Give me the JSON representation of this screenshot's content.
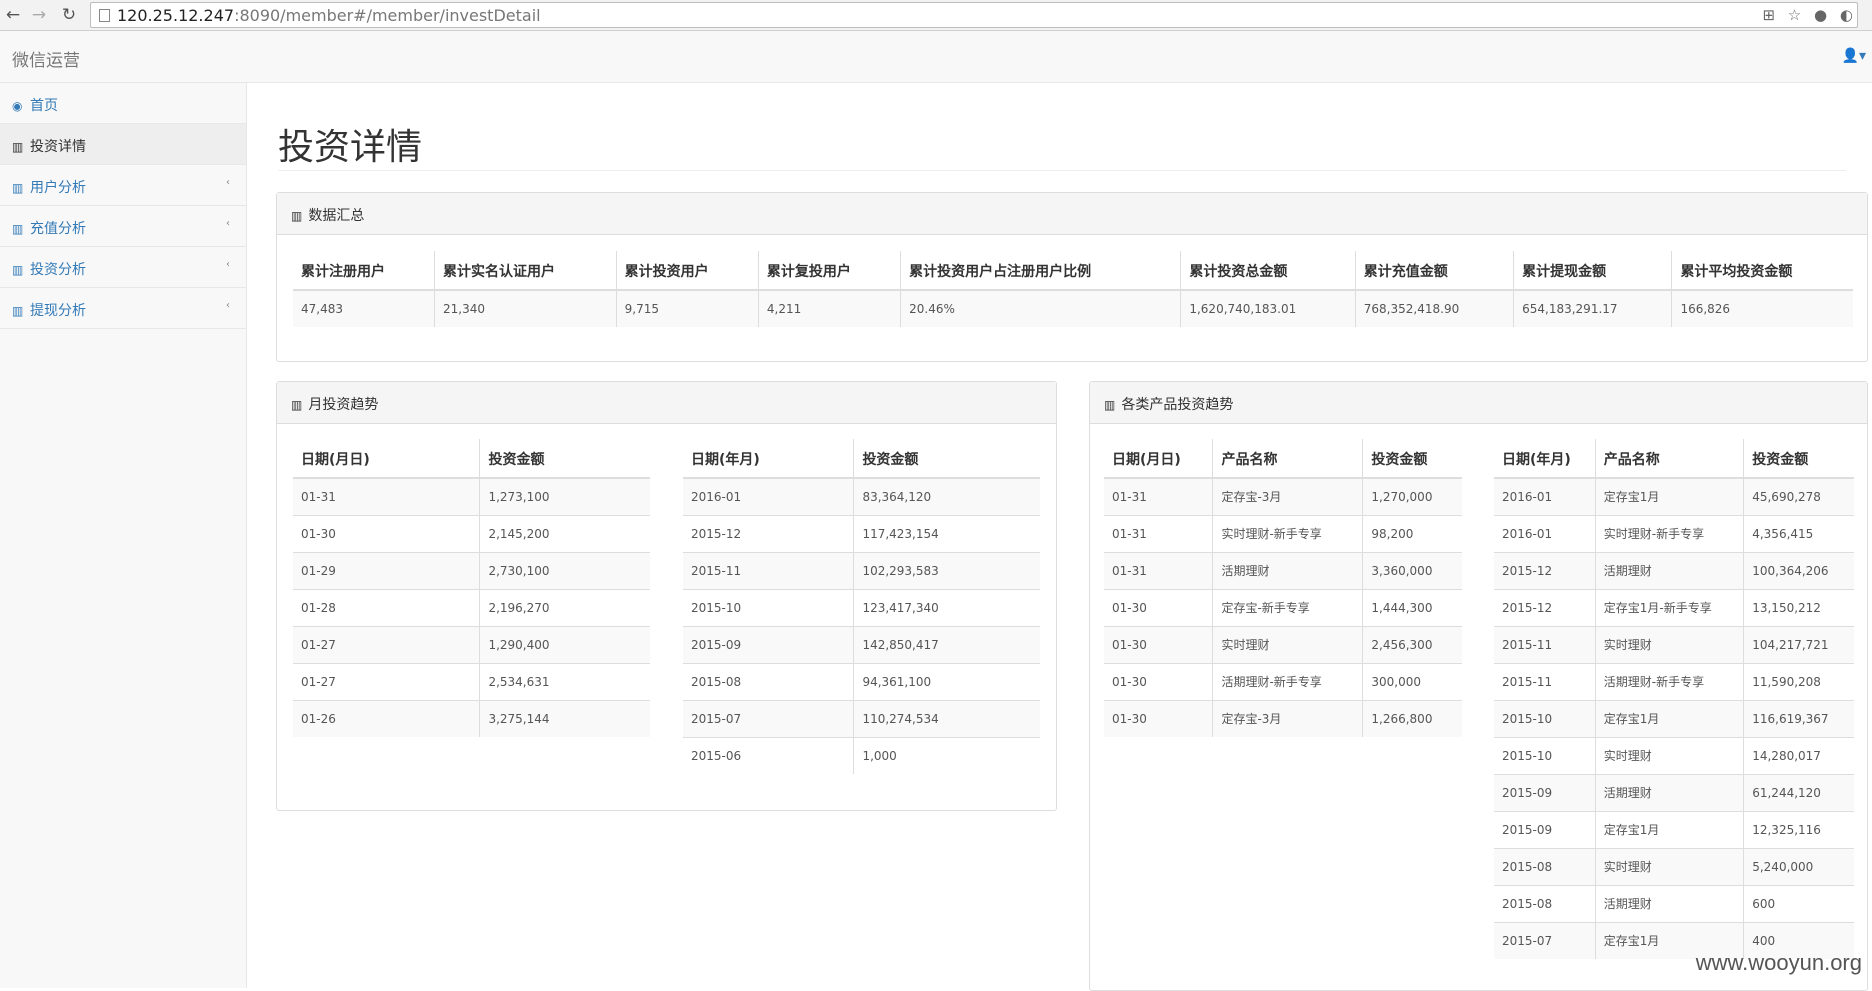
{
  "browser": {
    "url_host": "120.25.12.247",
    "url_rest": ":8090/member#/member/investDetail"
  },
  "navbar": {
    "brand": "微信运营"
  },
  "sidebar": {
    "items": [
      {
        "label": "首页",
        "icon": "dashboard-icon"
      },
      {
        "label": "投资详情",
        "icon": "bar-chart-icon"
      },
      {
        "label": "用户分析",
        "icon": "bar-chart-icon"
      },
      {
        "label": "充值分析",
        "icon": "bar-chart-icon"
      },
      {
        "label": "投资分析",
        "icon": "bar-chart-icon"
      },
      {
        "label": "提现分析",
        "icon": "bar-chart-icon"
      }
    ]
  },
  "main": {
    "title": "投资详情",
    "summary": {
      "heading": "数据汇总",
      "headers": [
        "累计注册用户",
        "累计实名认证用户",
        "累计投资用户",
        "累计复投用户",
        "累计投资用户占注册用户比例",
        "累计投资总金额",
        "累计充值金额",
        "累计提现金额",
        "累计平均投资金额"
      ],
      "row": [
        "47,483",
        "21,340",
        "9,715",
        "4,211",
        "20.46%",
        "1,620,740,183.01",
        "768,352,418.90",
        "654,183,291.17",
        "166,826"
      ]
    },
    "monthly": {
      "heading": "月投资趋势",
      "left": {
        "headers": [
          "日期(月日)",
          "投资金额"
        ],
        "rows": [
          [
            "01-31",
            "1,273,100"
          ],
          [
            "01-30",
            "2,145,200"
          ],
          [
            "01-29",
            "2,730,100"
          ],
          [
            "01-28",
            "2,196,270"
          ],
          [
            "01-27",
            "1,290,400"
          ],
          [
            "01-27",
            "2,534,631"
          ],
          [
            "01-26",
            "3,275,144"
          ]
        ]
      },
      "right": {
        "headers": [
          "日期(年月)",
          "投资金额"
        ],
        "rows": [
          [
            "2016-01",
            "83,364,120"
          ],
          [
            "2015-12",
            "117,423,154"
          ],
          [
            "2015-11",
            "102,293,583"
          ],
          [
            "2015-10",
            "123,417,340"
          ],
          [
            "2015-09",
            "142,850,417"
          ],
          [
            "2015-08",
            "94,361,100"
          ],
          [
            "2015-07",
            "110,274,534"
          ],
          [
            "2015-06",
            "1,000"
          ]
        ]
      }
    },
    "products": {
      "heading": "各类产品投资趋势",
      "left": {
        "headers": [
          "日期(月日)",
          "产品名称",
          "投资金额"
        ],
        "rows": [
          [
            "01-31",
            "定存宝-3月",
            "1,270,000"
          ],
          [
            "01-31",
            "实时理财-新手专享",
            "98,200"
          ],
          [
            "01-31",
            "活期理财",
            "3,360,000"
          ],
          [
            "01-30",
            "定存宝-新手专享",
            "1,444,300"
          ],
          [
            "01-30",
            "实时理财",
            "2,456,300"
          ],
          [
            "01-30",
            "活期理财-新手专享",
            "300,000"
          ],
          [
            "01-30",
            "定存宝-3月",
            "1,266,800"
          ]
        ]
      },
      "right": {
        "headers": [
          "日期(年月)",
          "产品名称",
          "投资金额"
        ],
        "rows": [
          [
            "2016-01",
            "定存宝1月",
            "45,690,278"
          ],
          [
            "2016-01",
            "实时理财-新手专享",
            "4,356,415"
          ],
          [
            "2015-12",
            "活期理财",
            "100,364,206"
          ],
          [
            "2015-12",
            "定存宝1月-新手专享",
            "13,150,212"
          ],
          [
            "2015-11",
            "实时理财",
            "104,217,721"
          ],
          [
            "2015-11",
            "活期理财-新手专享",
            "11,590,208"
          ],
          [
            "2015-10",
            "定存宝1月",
            "116,619,367"
          ],
          [
            "2015-10",
            "实时理财",
            "14,280,017"
          ],
          [
            "2015-09",
            "活期理财",
            "61,244,120"
          ],
          [
            "2015-09",
            "定存宝1月",
            "12,325,116"
          ],
          [
            "2015-08",
            "实时理财",
            "5,240,000"
          ],
          [
            "2015-08",
            "活期理财",
            "600"
          ],
          [
            "2015-07",
            "定存宝1月",
            "400"
          ]
        ]
      }
    }
  },
  "watermark": "www.wooyun.org"
}
